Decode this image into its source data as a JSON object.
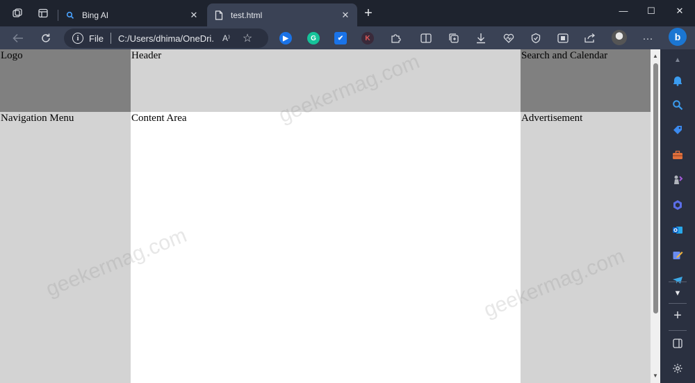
{
  "tabs": [
    {
      "label": "Bing AI",
      "icon": "search-icon"
    },
    {
      "label": "test.html",
      "icon": "document-icon"
    }
  ],
  "address_bar": {
    "scheme": "File",
    "url": "C:/Users/dhima/OneDri..."
  },
  "read_aloud_label": "A⁾",
  "page": {
    "logo": "Logo",
    "header": "Header",
    "search_calendar": "Search and Calendar",
    "navigation": "Navigation Menu",
    "content": "Content Area",
    "advertisement": "Advertisement"
  },
  "watermark": "geekermag.com",
  "colors": {
    "dark_cell": "#808080",
    "light_cell": "#d3d3d3",
    "content_bg": "#ffffff",
    "bing_accent": "#1b76d2"
  }
}
